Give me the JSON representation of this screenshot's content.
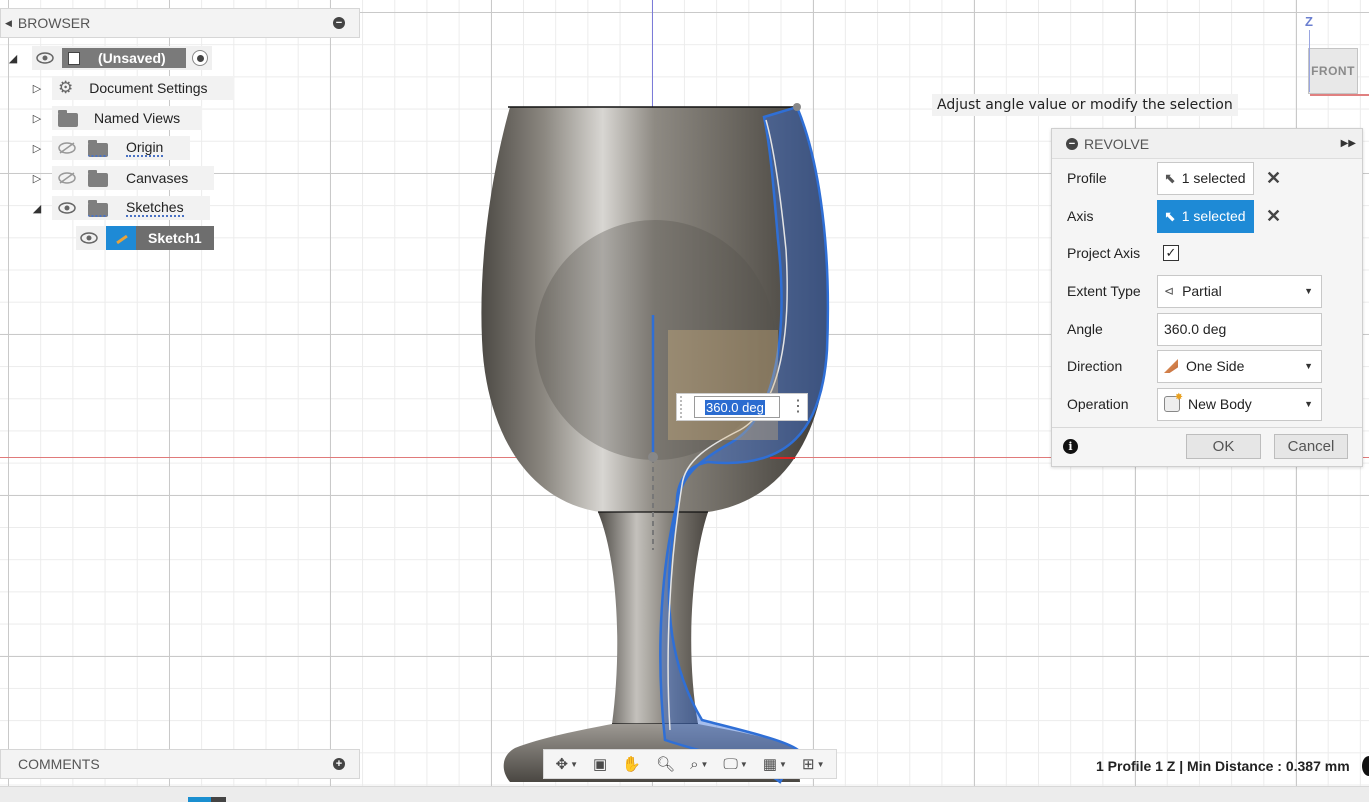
{
  "browser": {
    "title": "BROWSER",
    "root": {
      "label": "(Unsaved)"
    },
    "items": [
      {
        "label": "Document Settings"
      },
      {
        "label": "Named Views"
      },
      {
        "label": "Origin"
      },
      {
        "label": "Canvases"
      },
      {
        "label": "Sketches"
      },
      {
        "label": "Sketch1"
      }
    ]
  },
  "tooltip": "Adjust angle value or modify the selection",
  "revolve": {
    "title": "REVOLVE",
    "profile": {
      "label": "Profile",
      "value": "1 selected"
    },
    "axis": {
      "label": "Axis",
      "value": "1 selected"
    },
    "project_axis": {
      "label": "Project Axis",
      "checked": true
    },
    "extent_type": {
      "label": "Extent Type",
      "value": "Partial"
    },
    "angle": {
      "label": "Angle",
      "value": "360.0 deg"
    },
    "direction": {
      "label": "Direction",
      "value": "One Side"
    },
    "operation": {
      "label": "Operation",
      "value": "New Body"
    },
    "ok": "OK",
    "cancel": "Cancel"
  },
  "canvas_angle_input": "360.0 deg",
  "viewcube": {
    "face": "FRONT",
    "axis": "Z"
  },
  "comments": {
    "title": "COMMENTS"
  },
  "status": "1 Profile 1 Z | Min Distance : 0.387 mm",
  "colors": {
    "accent": "#1e8ad6",
    "selection_outline": "#2f6fd6"
  }
}
